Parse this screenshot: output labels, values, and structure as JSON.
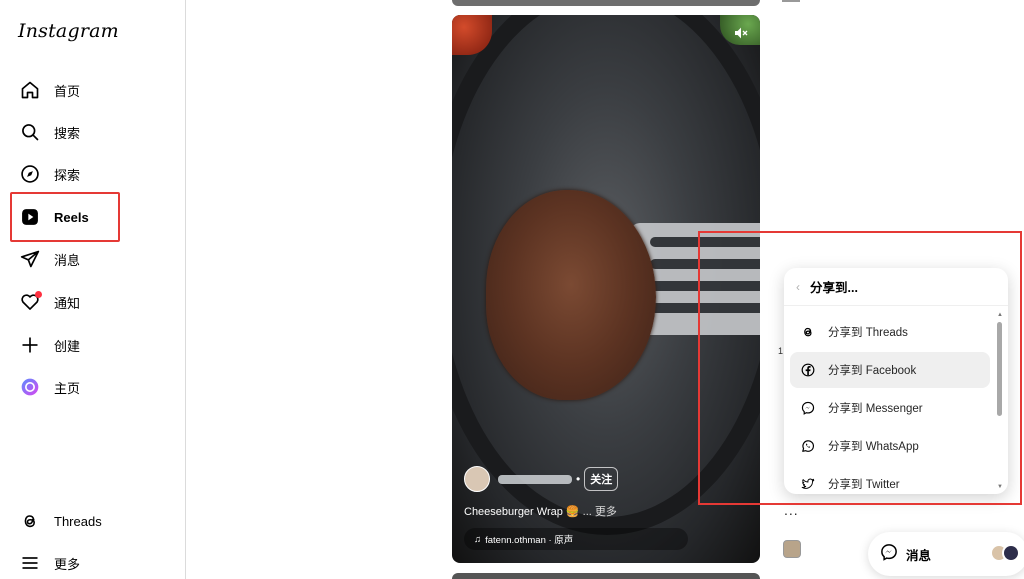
{
  "app": {
    "logo": "Instagram"
  },
  "sidebar": {
    "items": [
      {
        "label": "首页",
        "icon": "home-icon"
      },
      {
        "label": "搜索",
        "icon": "search-icon"
      },
      {
        "label": "探索",
        "icon": "compass-icon"
      },
      {
        "label": "Reels",
        "icon": "reels-icon",
        "active": true
      },
      {
        "label": "消息",
        "icon": "send-icon"
      },
      {
        "label": "通知",
        "icon": "heart-icon",
        "badge": true
      },
      {
        "label": "创建",
        "icon": "plus-icon"
      },
      {
        "label": "主页",
        "icon": "profile-avatar-icon"
      }
    ],
    "bottom": [
      {
        "label": "Threads",
        "icon": "threads-icon"
      },
      {
        "label": "更多",
        "icon": "menu-icon"
      }
    ]
  },
  "reel": {
    "follow_label": "关注",
    "caption": "Cheeseburger Wrap 🍔",
    "caption_more": "... 更多",
    "audio": "fatenn.othman · 原声"
  },
  "side": {
    "count": "1",
    "more_dots": "..."
  },
  "share": {
    "title": "分享到...",
    "items": [
      {
        "label": "分享到 Threads",
        "icon": "threads-icon"
      },
      {
        "label": "分享到 Facebook",
        "icon": "facebook-icon"
      },
      {
        "label": "分享到 Messenger",
        "icon": "messenger-icon"
      },
      {
        "label": "分享到 WhatsApp",
        "icon": "whatsapp-icon"
      },
      {
        "label": "分享到 Twitter",
        "icon": "twitter-icon"
      }
    ]
  },
  "messages_pill": {
    "label": "消息"
  },
  "colors": {
    "highlight": "#e53935",
    "badge": "#ff3040"
  }
}
